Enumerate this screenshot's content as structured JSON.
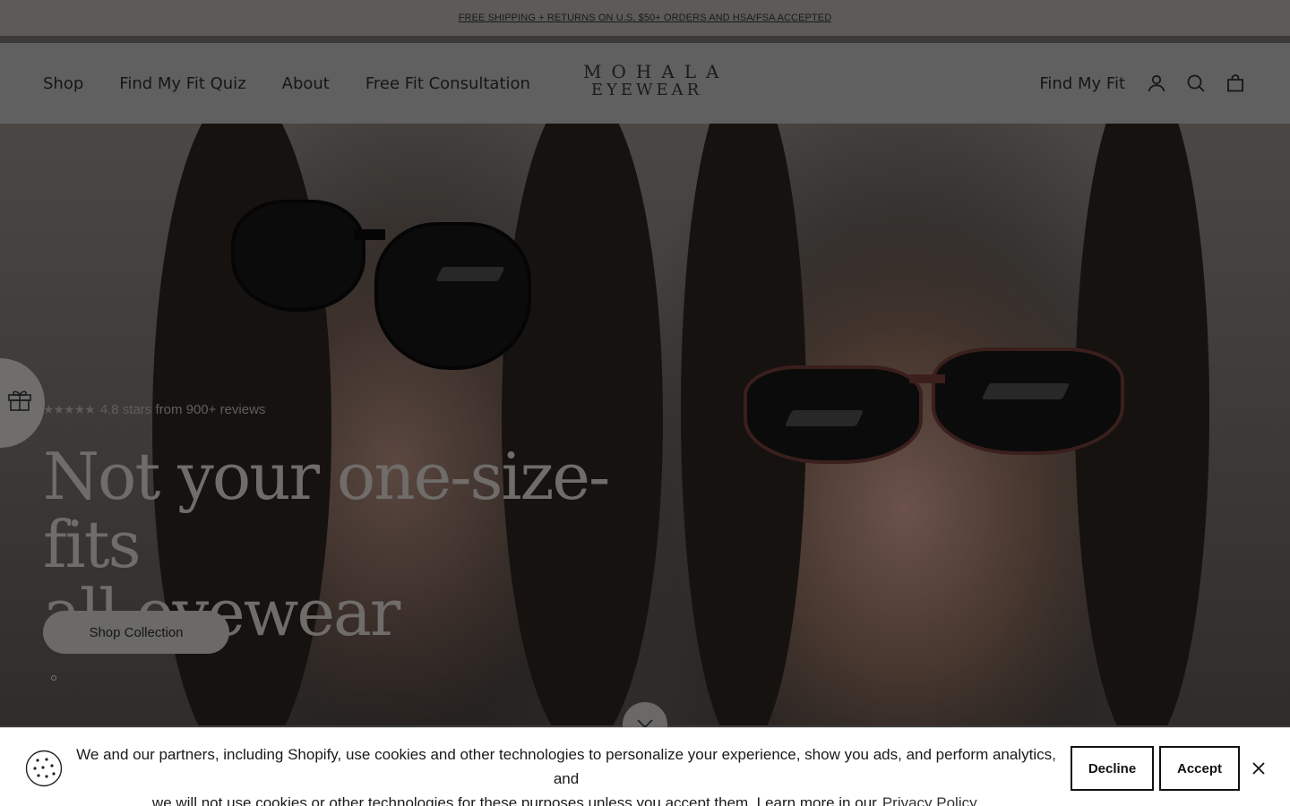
{
  "announcement": {
    "text": "FREE SHIPPING + RETURNS ON U.S. $50+ ORDERS AND HSA/FSA ACCEPTED"
  },
  "header": {
    "nav_left": [
      "Shop",
      "Find My Fit Quiz",
      "About",
      "Free Fit Consultation"
    ],
    "logo_line1": "MOHALA",
    "logo_line2": "EYEWEAR",
    "find_my_fit": "Find My Fit",
    "icons": [
      "account-icon",
      "search-icon",
      "bag-icon"
    ]
  },
  "hero": {
    "rating_stars": "★★★★★",
    "rating_text": "4.8 stars from 900+ reviews",
    "headline_line1": "Not your one-size-fits",
    "headline_line2": "all eyewear",
    "cta_label": "Shop Collection"
  },
  "side_tab": {
    "icon": "gift-icon"
  },
  "cookie_banner": {
    "line1": "We and our partners, including Shopify, use cookies and other technologies to personalize your experience, show you ads, and perform analytics, and",
    "line2": "we will not use cookies or other technologies for these purposes unless you accept them. Learn more in our",
    "link_text": "Privacy Policy.",
    "decline_label": "Decline",
    "accept_label": "Accept",
    "icon": "cookie-icon"
  },
  "colors": {
    "overlay_bg": "#3b3a38",
    "banner_bg": "#ffffff",
    "text_dark": "#111111"
  }
}
